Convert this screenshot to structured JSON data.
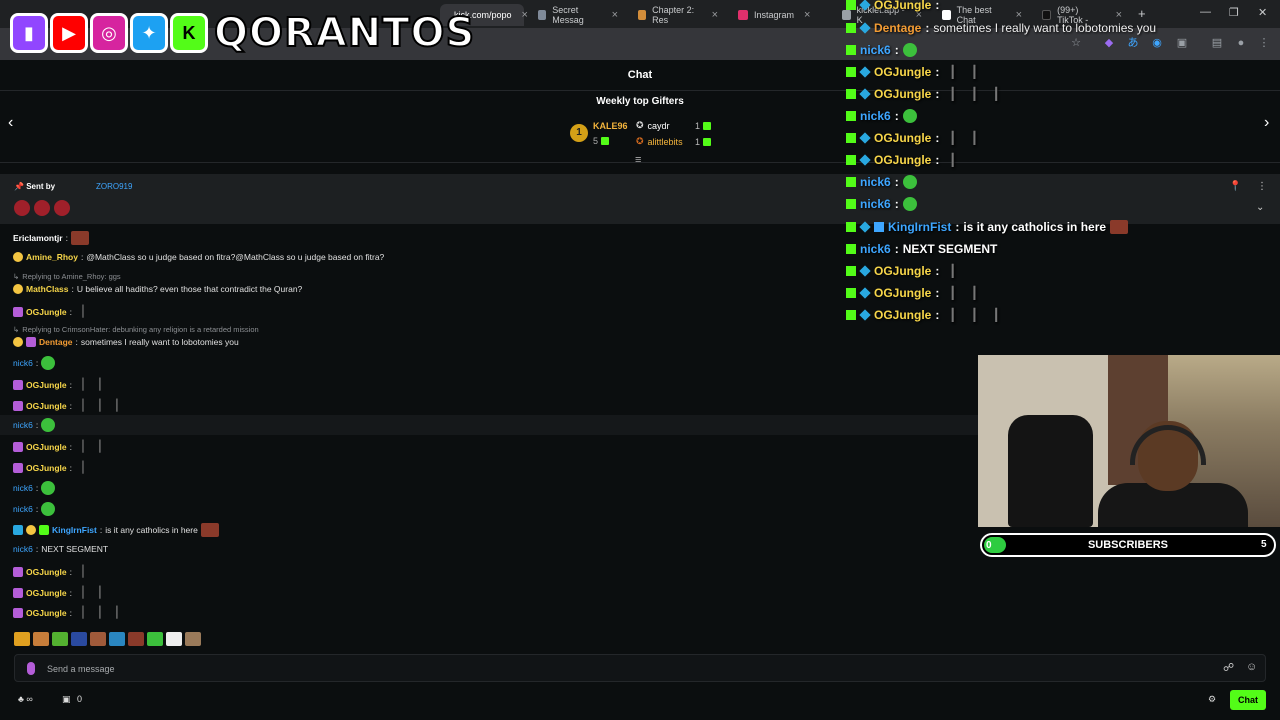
{
  "browser": {
    "tabs": [
      {
        "label": "kick.com/popo",
        "color": "#53fc18"
      },
      {
        "label": "Secret Messag",
        "color": "#7f8a99"
      },
      {
        "label": "Chapter 2: Res",
        "color": "#d28d3a"
      },
      {
        "label": "Instagram",
        "color": "#e1306c"
      },
      {
        "label": "kicklet.app - K",
        "color": "#9aa0a6"
      },
      {
        "label": "The best Chat",
        "color": "#ffffff"
      },
      {
        "label": "(99+) TikTok - ",
        "color": "#111111"
      }
    ]
  },
  "overlay_brand": {
    "name": "QORANTOS",
    "socials": [
      "twitch",
      "youtube",
      "instagram",
      "twitter",
      "kick"
    ]
  },
  "chat": {
    "title": "Chat",
    "weekly_top_gifters_title": "Weekly top Gifters",
    "top_gifter": {
      "rank": "1",
      "name": "KALE96",
      "count": "5"
    },
    "gifters": [
      {
        "name": "caydr",
        "count": "1",
        "color": "#ffffff"
      },
      {
        "name": "alittlebits",
        "count": "1",
        "color": "#f3b43c"
      }
    ],
    "pinned": {
      "sent_by_label": "Sent by",
      "user": "ZORO919"
    },
    "messages": [
      {
        "user": "Ericlamontjr",
        "color": "#ffffff",
        "text": ""
      },
      {
        "user": "Amine_Rhoy",
        "color": "#f7d64a",
        "text": "@MathClass so u judge based on fitra?@MathClass so u judge based on fitra?"
      },
      {
        "reply": "Replying to Amine_Rhoy: ggs"
      },
      {
        "user": "MathClass",
        "color": "#f7d64a",
        "text": "U believe all hadiths? even those that contradict the Quran?"
      },
      {
        "user": "OGJungle",
        "color": "#f7d64a",
        "text": ""
      },
      {
        "reply": "Replying to CrimsonHater: debunking any religion is a retarded mission"
      },
      {
        "user": "Dentage",
        "color": "#f39c34",
        "text": "sometimes I really want to lobotomies you"
      },
      {
        "user": "nick6",
        "color": "#3ea6ff",
        "text": ""
      },
      {
        "user": "OGJungle",
        "color": "#f7d64a",
        "text": ""
      },
      {
        "user": "OGJungle",
        "color": "#f7d64a",
        "text": ""
      },
      {
        "user": "nick6",
        "color": "#3ea6ff",
        "text": ""
      },
      {
        "user": "OGJungle",
        "color": "#f7d64a",
        "text": ""
      },
      {
        "user": "OGJungle",
        "color": "#f7d64a",
        "text": ""
      },
      {
        "user": "nick6",
        "color": "#3ea6ff",
        "text": ""
      },
      {
        "user": "nick6",
        "color": "#3ea6ff",
        "text": ""
      },
      {
        "user": "KingIrnFist",
        "color": "#3ea6ff",
        "text": "is it any catholics in here"
      },
      {
        "user": "nick6",
        "color": "#3ea6ff",
        "text": "NEXT SEGMENT"
      },
      {
        "user": "OGJungle",
        "color": "#f7d64a",
        "text": ""
      },
      {
        "user": "OGJungle",
        "color": "#f7d64a",
        "text": ""
      },
      {
        "user": "OGJungle",
        "color": "#f7d64a",
        "text": ""
      }
    ],
    "input_placeholder": "Send a message",
    "footer_count": "0",
    "chat_button": "Chat"
  },
  "overlay_chat": {
    "messages": [
      {
        "user": "OGJungle",
        "text": "",
        "bars": 1
      },
      {
        "user": "Dentage",
        "text": "sometimes I really want to lobotomies you",
        "bars": 0
      },
      {
        "user": "nick6",
        "text": "",
        "bars": 0
      },
      {
        "user": "OGJungle",
        "text": "",
        "bars": 2
      },
      {
        "user": "OGJungle",
        "text": "",
        "bars": 3
      },
      {
        "user": "nick6",
        "text": "",
        "bars": 0
      },
      {
        "user": "OGJungle",
        "text": "",
        "bars": 2
      },
      {
        "user": "OGJungle",
        "text": "",
        "bars": 1
      },
      {
        "user": "nick6",
        "text": "",
        "bars": 0
      },
      {
        "user": "nick6",
        "text": "",
        "bars": 0
      },
      {
        "user": "KingIrnFist",
        "text": "is it any catholics in here",
        "bars": 0
      },
      {
        "user": "nick6",
        "text": "NEXT SEGMENT",
        "bars": 0
      },
      {
        "user": "OGJungle",
        "text": "",
        "bars": 1
      },
      {
        "user": "OGJungle",
        "text": "",
        "bars": 2
      },
      {
        "user": "OGJungle",
        "text": "",
        "bars": 3
      }
    ]
  },
  "subscribers": {
    "label": "SUBSCRIBERS",
    "current": "0",
    "goal": "5",
    "progress_fraction": 0.0
  },
  "colors": {
    "kick_green": "#53fc18",
    "bg": "#0b0e0f",
    "nick_blue": "#3ea6ff",
    "og_yellow": "#f7d64a"
  }
}
